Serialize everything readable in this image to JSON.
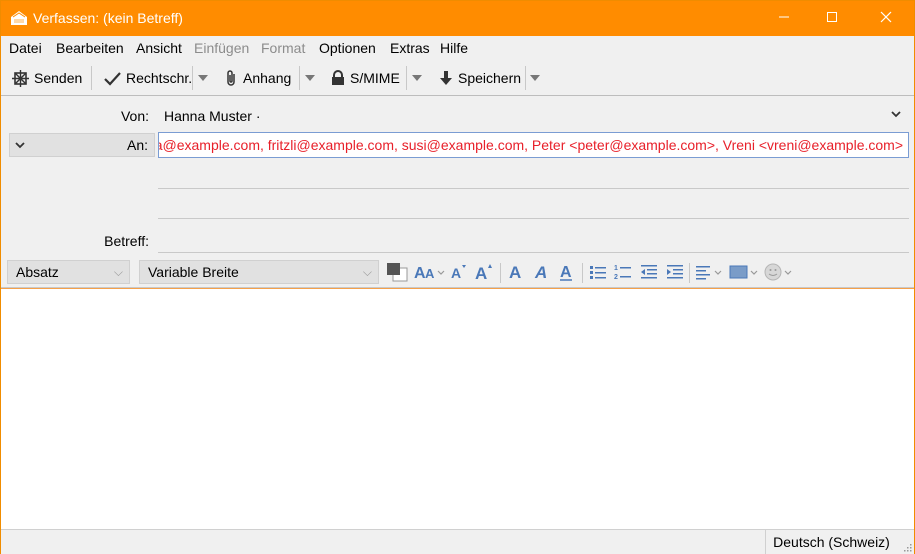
{
  "window": {
    "title": "Verfassen: (kein Betreff)",
    "accent": "#ff8c00"
  },
  "menu": [
    {
      "label": "Datei",
      "enabled": true
    },
    {
      "label": "Bearbeiten",
      "enabled": true
    },
    {
      "label": "Ansicht",
      "enabled": true
    },
    {
      "label": "Einfügen",
      "enabled": false
    },
    {
      "label": "Format",
      "enabled": false
    },
    {
      "label": "Optionen",
      "enabled": true
    },
    {
      "label": "Extras",
      "enabled": true
    },
    {
      "label": "Hilfe",
      "enabled": true
    }
  ],
  "toolbar": {
    "send_label": "Senden",
    "spell_label": "Rechtschr.",
    "attach_label": "Anhang",
    "smime_label": "S/MIME",
    "save_label": "Speichern"
  },
  "header": {
    "from_label": "Von:",
    "from_value": "Hanna Muster ·",
    "to_label": "An:",
    "to_value": "ına@example.com, fritzli@example.com, susi@example.com, Peter <peter@example.com>, Vreni <vreni@example.com>",
    "subject_label": "Betreff:",
    "recipient_color": "#e8202a"
  },
  "format": {
    "paragraph_style": "Absatz",
    "font": "Variable Breite"
  },
  "status": {
    "language": "Deutsch (Schweiz)"
  }
}
